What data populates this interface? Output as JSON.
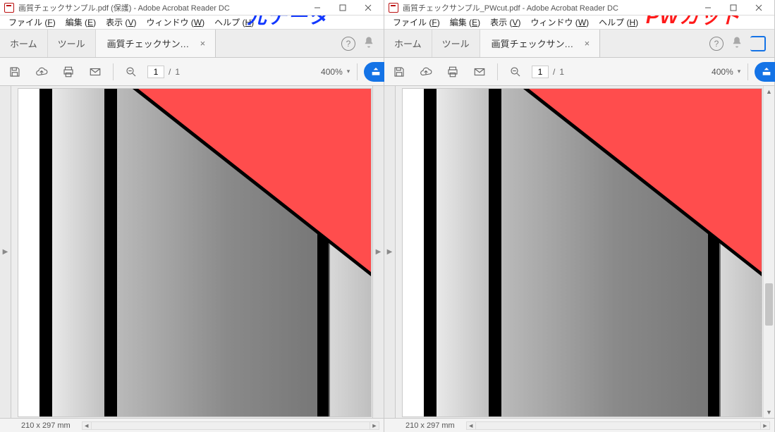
{
  "panes": [
    {
      "overlay": "元データ",
      "title": "画質チェックサンプル.pdf (保護) - Adobe Acrobat Reader DC",
      "menus": [
        {
          "label": "ファイル",
          "mn": "F"
        },
        {
          "label": "編集",
          "mn": "E"
        },
        {
          "label": "表示",
          "mn": "V"
        },
        {
          "label": "ウィンドウ",
          "mn": "W"
        },
        {
          "label": "ヘルプ",
          "mn": "H"
        }
      ],
      "tabs": {
        "home": "ホーム",
        "tools": "ツール",
        "doc": "画質チェックサンプ..."
      },
      "page": {
        "current": "1",
        "total": "1"
      },
      "zoom": "400%",
      "dims": "210 x 297 mm"
    },
    {
      "overlay": "PWカット",
      "title": "画質チェックサンプル_PWcut.pdf - Adobe Acrobat Reader DC",
      "menus": [
        {
          "label": "ファイル",
          "mn": "F"
        },
        {
          "label": "編集",
          "mn": "E"
        },
        {
          "label": "表示",
          "mn": "V"
        },
        {
          "label": "ウィンドウ",
          "mn": "W"
        },
        {
          "label": "ヘルプ",
          "mn": "H"
        }
      ],
      "tabs": {
        "home": "ホーム",
        "tools": "ツール",
        "doc": "画質チェックサンプ..."
      },
      "page": {
        "current": "1",
        "total": "1"
      },
      "zoom": "400%",
      "dims": "210 x 297 mm"
    }
  ]
}
